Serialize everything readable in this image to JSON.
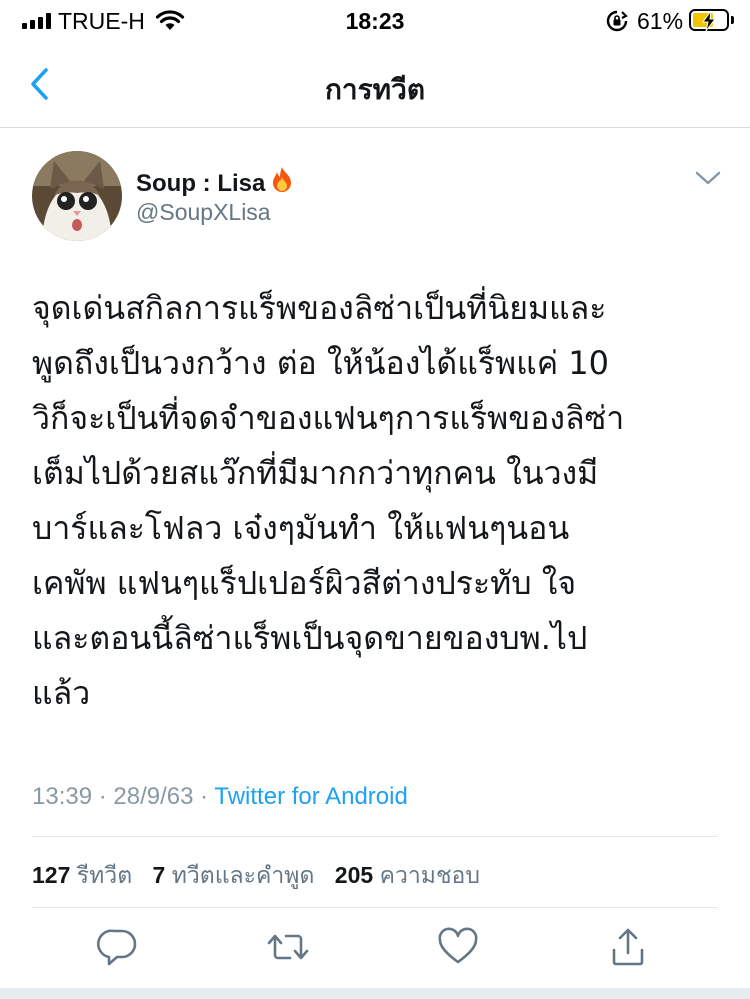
{
  "status_bar": {
    "carrier": "TRUE-H",
    "time": "18:23",
    "battery_percent": "61%",
    "battery_level": 0.61,
    "signal_bars": 4
  },
  "nav": {
    "back_icon": "chevron-left-icon",
    "title": "การทวีต"
  },
  "tweet": {
    "author_name": "Soup : Lisa",
    "author_emoji": "fire-icon",
    "handle": "@SoupXLisa",
    "text_lines": [
      "จุดเด่นสกิลการแร็พของลิซ่าเป็นที่นิยมและ",
      "พูดถึงเป็นวงกว้าง ต่อ ให้น้องได้แร็พแค่ 10",
      "วิก็จะเป็นที่จดจำของแฟนๆการแร็พของลิซ่า",
      "เต็มไปด้วยสแว๊กที่มีมากกว่าทุกคน ในวงมี",
      "บาร์และโฟลว เจ๋งๆมันทำ ให้แฟนๆนอน",
      "เคพัพ แฟนๆแร็ปเปอร์ผิวสีต่างประทับ ใจ",
      "และตอนนี้ลิซ่าแร็พเป็นจุดขายของบพ.ไป",
      "แล้ว"
    ],
    "time": "13:39",
    "date": "28/9/63",
    "separator": "·",
    "source": "Twitter for Android"
  },
  "stats": {
    "retweets_count": "127",
    "retweets_label": "รีทวีต",
    "quotes_count": "7",
    "quotes_label": "ทวีตและคำพูด",
    "likes_count": "205",
    "likes_label": "ความชอบ"
  },
  "actions": {
    "reply_icon": "reply-icon",
    "retweet_icon": "retweet-icon",
    "like_icon": "heart-icon",
    "share_icon": "share-icon"
  },
  "colors": {
    "link": "#1da1f2",
    "secondary_text": "#657786",
    "meta_text": "#8899a6",
    "icon": "#657786",
    "back": "#1da1f2",
    "battery_fill": "#f5c400"
  }
}
